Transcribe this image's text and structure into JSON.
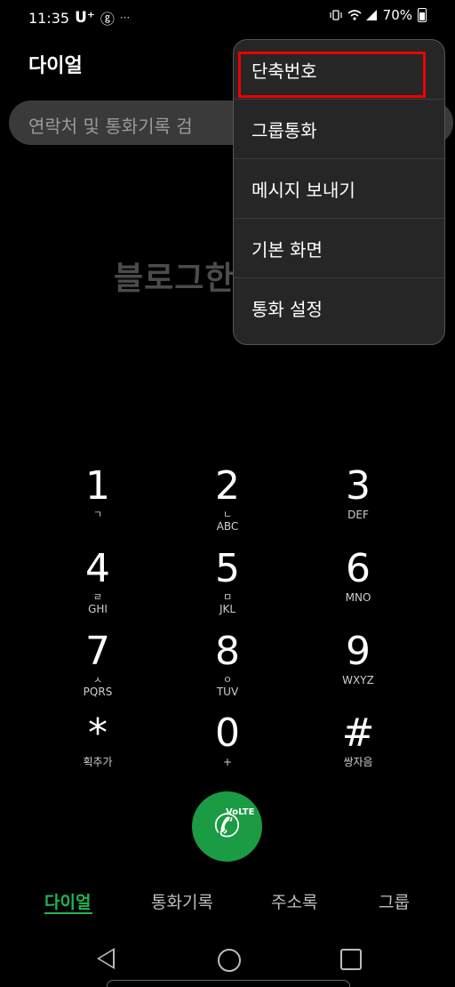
{
  "status_bar": {
    "time": "11:35",
    "carrier": "U⁺",
    "carrier_badge": "ⓖ",
    "more": "···",
    "battery": "70%"
  },
  "header": {
    "title": "다이얼"
  },
  "search": {
    "placeholder": "연락처 및 통화기록 검"
  },
  "watermark": "블로그한경닷컴",
  "menu": {
    "items": [
      "단축번호",
      "그룹통화",
      "메시지 보내기",
      "기본 화면",
      "통화 설정"
    ]
  },
  "keypad": [
    {
      "digit": "1",
      "sub1": "ㄱ",
      "sub2": ""
    },
    {
      "digit": "2",
      "sub1": "ㄴ",
      "sub2": "ABC"
    },
    {
      "digit": "3",
      "sub1": "",
      "sub2": "DEF"
    },
    {
      "digit": "4",
      "sub1": "ㄹ",
      "sub2": "GHI"
    },
    {
      "digit": "5",
      "sub1": "ㅁ",
      "sub2": "JKL"
    },
    {
      "digit": "6",
      "sub1": "",
      "sub2": "MNO"
    },
    {
      "digit": "7",
      "sub1": "ㅅ",
      "sub2": "PQRS"
    },
    {
      "digit": "8",
      "sub1": "ㅇ",
      "sub2": "TUV"
    },
    {
      "digit": "9",
      "sub1": "",
      "sub2": "WXYZ"
    },
    {
      "digit": "*",
      "sub1": "",
      "sub2": "획추가"
    },
    {
      "digit": "0",
      "sub1": "",
      "sub2": "+"
    },
    {
      "digit": "#",
      "sub1": "",
      "sub2": "쌍자음"
    }
  ],
  "call_button": {
    "badge": "VoLTE",
    "icon": "phone-icon"
  },
  "tabs": [
    {
      "label": "다이얼",
      "active": true
    },
    {
      "label": "통화기록",
      "active": false
    },
    {
      "label": "주소록",
      "active": false
    },
    {
      "label": "그룹",
      "active": false
    }
  ],
  "colors": {
    "accent": "#22b553",
    "call_button": "#1a9b44",
    "highlight": "#e00000"
  }
}
